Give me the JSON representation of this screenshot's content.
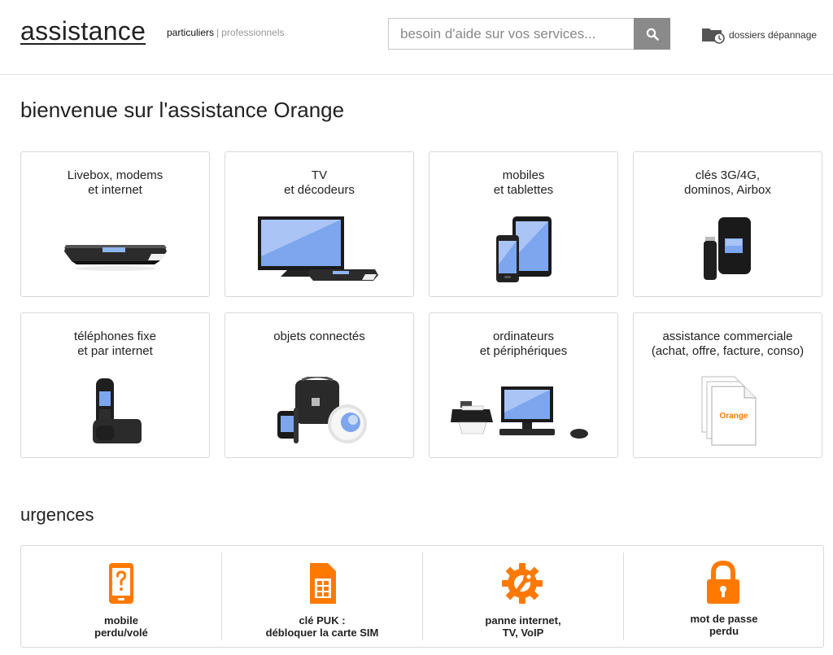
{
  "header": {
    "logo": "assistance",
    "segment_active": "particuliers",
    "segment_separator": "|",
    "segment_other": "professionnels",
    "search_placeholder": "besoin d'aide sur vos services...",
    "search_icon": "search-icon",
    "folders_label": "dossiers dépannage",
    "folders_icon": "folder-clock-icon"
  },
  "page_title": "bienvenue sur l'assistance Orange",
  "tiles": [
    {
      "label": "Livebox, modems\net internet",
      "icon": "livebox-icon"
    },
    {
      "label": "TV\net décodeurs",
      "icon": "tv-icon"
    },
    {
      "label": "mobiles\net tablettes",
      "icon": "mobile-tablet-icon"
    },
    {
      "label": "clés 3G/4G,\ndominos, Airbox",
      "icon": "usb-key-icon"
    },
    {
      "label": "téléphones fixe\net par internet",
      "icon": "home-phone-icon"
    },
    {
      "label": "objets connectés",
      "icon": "connected-objects-icon"
    },
    {
      "label": "ordinateurs\net périphériques",
      "icon": "computer-icon"
    },
    {
      "label": "assistance commerciale\n(achat, offre, facture, conso)",
      "icon": "invoice-icon",
      "doc_text": "Orange"
    }
  ],
  "urgences": {
    "title": "urgences",
    "items": [
      {
        "label": "mobile\nperdu/volé",
        "icon": "lost-phone-icon"
      },
      {
        "label": "clé PUK :\ndébloquer la carte SIM",
        "icon": "sim-card-icon"
      },
      {
        "label": "panne internet,\nTV, VoIP",
        "icon": "gear-wrench-icon"
      },
      {
        "label": "mot de passe\nperdu",
        "icon": "padlock-icon"
      }
    ]
  },
  "colors": {
    "accent": "#ff7900",
    "text": "#222222",
    "border": "#d9d9d9",
    "search_button": "#8a8a8a"
  }
}
